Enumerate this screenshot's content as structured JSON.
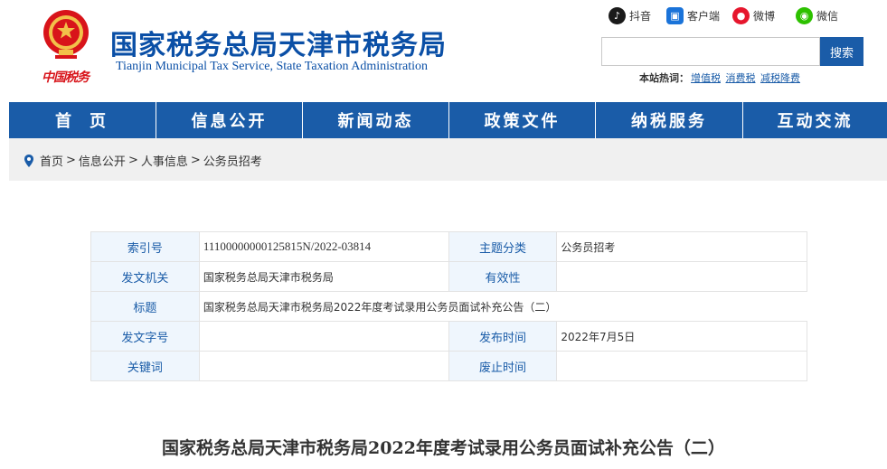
{
  "header": {
    "logo_text": "中国税务",
    "title": "国家税务总局天津市税务局",
    "subtitle_en": "Tianjin Municipal Tax Service, State Taxation Administration"
  },
  "social": [
    {
      "label": "抖音",
      "icon": "douyin-icon",
      "color": "#1a1a1a"
    },
    {
      "label": "客户端",
      "icon": "app-client-icon",
      "color": "#1a73d9"
    },
    {
      "label": "微博",
      "icon": "weibo-icon",
      "color": "#e6162d"
    },
    {
      "label": "微信",
      "icon": "wechat-icon",
      "color": "#2dc100"
    }
  ],
  "search": {
    "placeholder": "",
    "button_label": "搜索",
    "hot_label": "本站热词：",
    "hot_words": [
      "增值税",
      "消费税",
      "减税降费"
    ]
  },
  "nav": {
    "items": [
      "首页",
      "信息公开",
      "新闻动态",
      "政策文件",
      "纳税服务",
      "互动交流"
    ]
  },
  "breadcrumb": {
    "items": [
      "首页",
      "信息公开",
      "人事信息",
      "公务员招考"
    ],
    "separator": ">"
  },
  "meta": {
    "index_label": "索引号",
    "index_value": "11100000000125815N/2022-03814",
    "topic_label": "主题分类",
    "topic_value": "公务员招考",
    "issuer_label": "发文机关",
    "issuer_value": "国家税务总局天津市税务局",
    "validity_label": "有效性",
    "validity_value": "",
    "title_label": "标题",
    "title_value": "国家税务总局天津市税务局2022年度考试录用公务员面试补充公告（二）",
    "doc_no_label": "发文字号",
    "doc_no_value": "",
    "publish_label": "发布时间",
    "publish_value": "2022年7月5日",
    "keywords_label": "关键词",
    "keywords_value": "",
    "expire_label": "废止时间",
    "expire_value": ""
  },
  "article": {
    "title": "国家税务总局天津市税务局2022年度考试录用公务员面试补充公告（二）"
  },
  "colors": {
    "brand_blue": "#1a5ca8",
    "title_blue": "#0a4fa6",
    "logo_red": "#d8141a",
    "label_bg": "#eff6fd"
  }
}
